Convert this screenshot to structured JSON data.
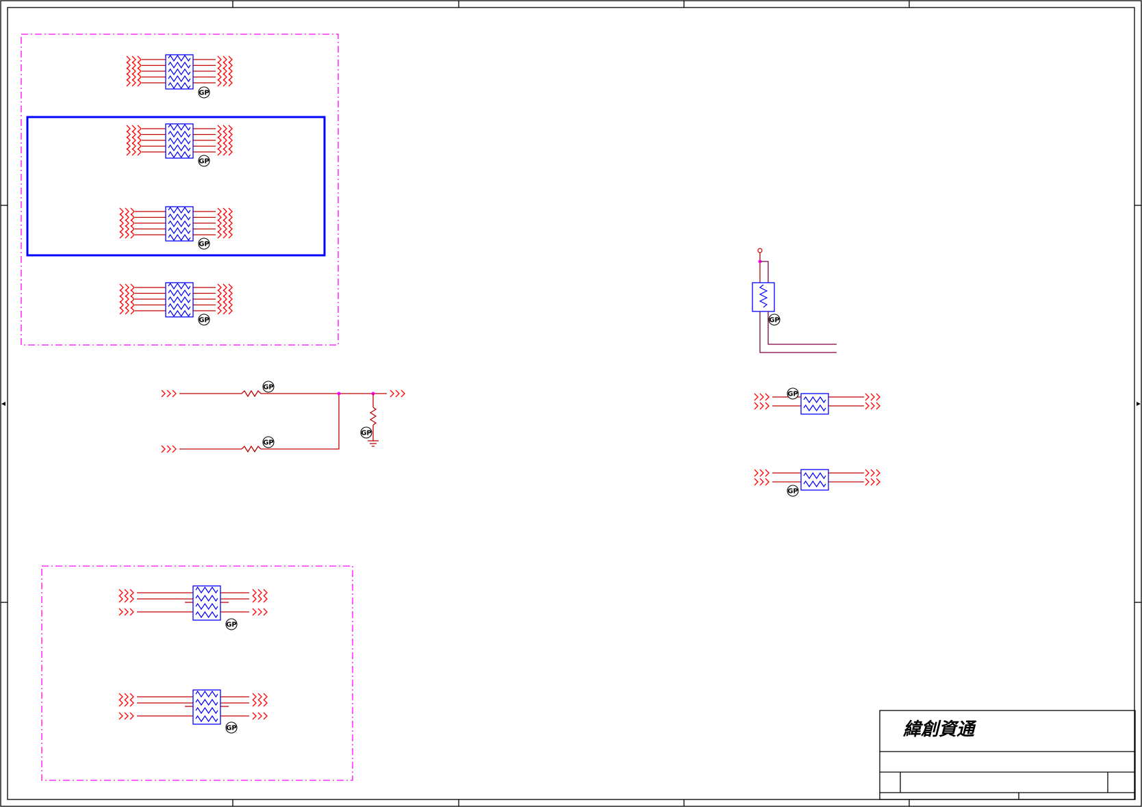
{
  "title_block": {
    "company": "緯創資通"
  },
  "marks": {
    "gp_label": "GP"
  },
  "colors": {
    "wire": "#c00000",
    "arrow": "#ff0000",
    "component": "#0000ff",
    "dash_box": "#ff00ff",
    "border": "#000000"
  }
}
